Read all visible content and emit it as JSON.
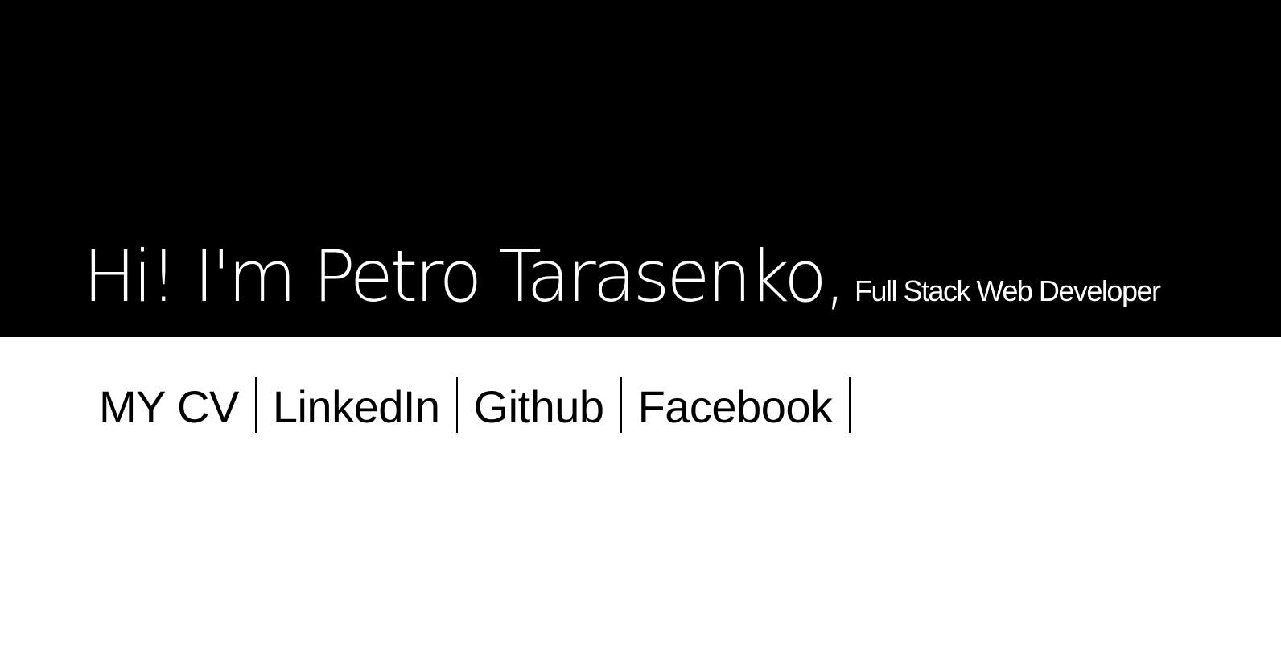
{
  "hero": {
    "name": "Hi! I'm Petro Tarasenko,",
    "role": "Full Stack Web Developer"
  },
  "links": [
    {
      "label": "MY CV"
    },
    {
      "label": "LinkedIn"
    },
    {
      "label": "Github"
    },
    {
      "label": "Facebook"
    }
  ],
  "colors": {
    "hero_background": "#000000",
    "hero_text": "#ffffff",
    "page_background": "#ffffff",
    "link_text": "#000000"
  }
}
